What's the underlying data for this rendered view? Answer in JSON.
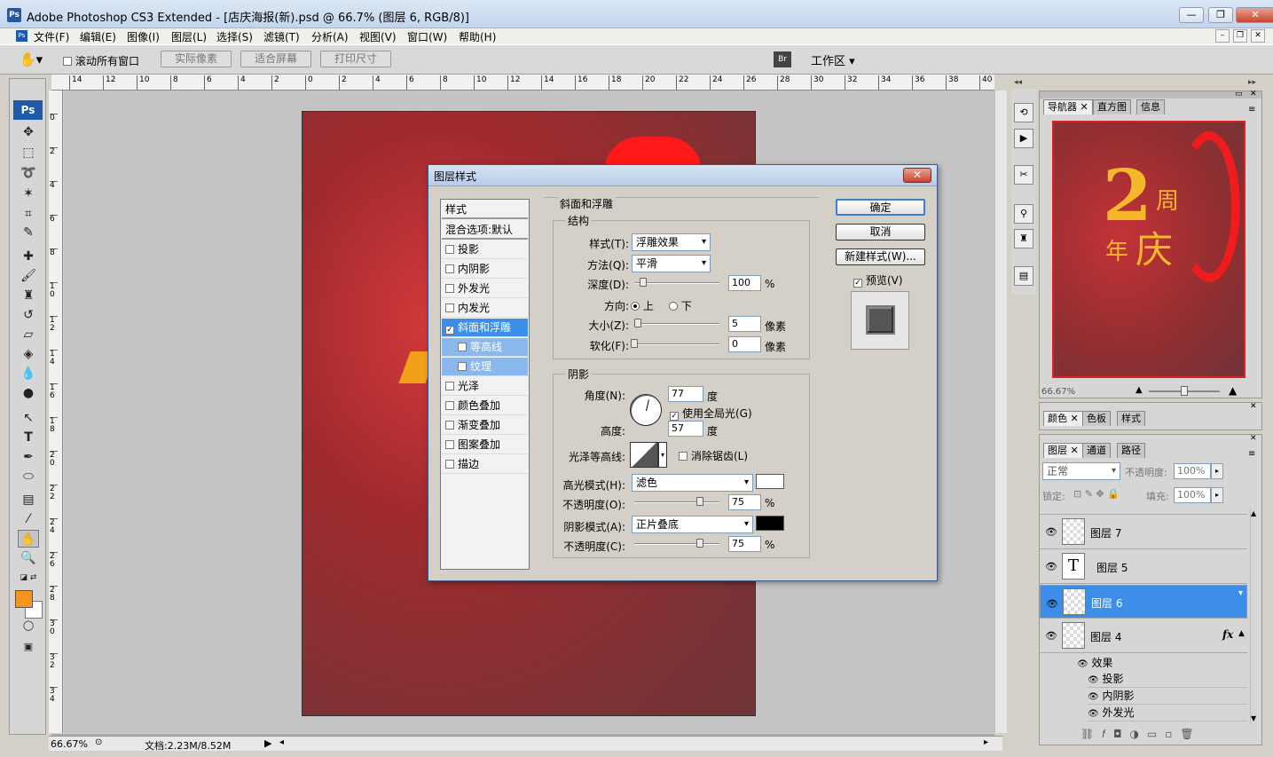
{
  "window": {
    "title": "Adobe Photoshop CS3 Extended - [店庆海报(新).psd @ 66.7% (图层 6, RGB/8)]",
    "ps_badge": "Ps"
  },
  "menu": [
    "文件(F)",
    "编辑(E)",
    "图像(I)",
    "图层(L)",
    "选择(S)",
    "滤镜(T)",
    "分析(A)",
    "视图(V)",
    "窗口(W)",
    "帮助(H)"
  ],
  "options": {
    "scroll_all": "滚动所有窗口",
    "actual_pixels": "实际像素",
    "fit_screen": "适合屏幕",
    "print_size": "打印尺寸",
    "workspace": "工作区 ▾"
  },
  "ruler_h": [
    "14",
    "12",
    "10",
    "8",
    "6",
    "4",
    "2",
    "0",
    "2",
    "4",
    "6",
    "8",
    "10",
    "12",
    "14",
    "16",
    "18",
    "20",
    "22",
    "24",
    "26",
    "28",
    "30",
    "32",
    "34",
    "36",
    "38",
    "40"
  ],
  "ruler_v": [
    "0",
    "2",
    "4",
    "6",
    "8",
    "10",
    "12",
    "14",
    "16",
    "18",
    "20",
    "22",
    "24",
    "26",
    "28",
    "30",
    "32",
    "34"
  ],
  "status": {
    "zoom": "66.67%",
    "doc": "文档:2.23M/8.52M"
  },
  "navigator": {
    "tabs": [
      "导航器",
      "直方图",
      "信息"
    ],
    "zoom": "66.67%",
    "art_big": "2",
    "art_zhou": "周",
    "art_nian": "年",
    "art_qing": "庆"
  },
  "color_panel": {
    "tabs": [
      "颜色",
      "色板",
      "样式"
    ]
  },
  "layers_panel": {
    "tabs": [
      "图层",
      "通道",
      "路径"
    ],
    "blend": "正常",
    "opacity_label": "不透明度:",
    "opacity": "100%",
    "lock_label": "锁定:",
    "fill_label": "填充:",
    "fill": "100%",
    "layers": [
      {
        "name": "图层 7",
        "selected": false,
        "type": "pixel"
      },
      {
        "name": "图层 5",
        "selected": false,
        "type": "text",
        "glyph": "T"
      },
      {
        "name": "图层 6",
        "selected": true,
        "type": "pixel"
      },
      {
        "name": "图层 4",
        "selected": false,
        "type": "pixel",
        "fx": "fx"
      }
    ],
    "effects_label": "效果",
    "effects": [
      "投影",
      "内阴影",
      "外发光"
    ]
  },
  "dialog": {
    "title": "图层样式",
    "styles": [
      {
        "label": "样式",
        "checkbox": false,
        "state": "header"
      },
      {
        "label": "混合选项:默认",
        "checkbox": false,
        "state": "header"
      },
      {
        "label": "投影",
        "checkbox": true,
        "checked": false,
        "state": ""
      },
      {
        "label": "内阴影",
        "checkbox": true,
        "checked": false,
        "state": ""
      },
      {
        "label": "外发光",
        "checkbox": true,
        "checked": false,
        "state": ""
      },
      {
        "label": "内发光",
        "checkbox": true,
        "checked": false,
        "state": ""
      },
      {
        "label": "斜面和浮雕",
        "checkbox": true,
        "checked": true,
        "state": "on"
      },
      {
        "label": "等高线",
        "checkbox": true,
        "checked": false,
        "state": "sub"
      },
      {
        "label": "纹理",
        "checkbox": true,
        "checked": false,
        "state": "sub"
      },
      {
        "label": "光泽",
        "checkbox": true,
        "checked": false,
        "state": ""
      },
      {
        "label": "颜色叠加",
        "checkbox": true,
        "checked": false,
        "state": ""
      },
      {
        "label": "渐变叠加",
        "checkbox": true,
        "checked": false,
        "state": ""
      },
      {
        "label": "图案叠加",
        "checkbox": true,
        "checked": false,
        "state": ""
      },
      {
        "label": "描边",
        "checkbox": true,
        "checked": false,
        "state": ""
      }
    ],
    "section": "斜面和浮雕",
    "structure": {
      "title": "结构",
      "style_label": "样式(T):",
      "style_value": "浮雕效果",
      "technique_label": "方法(Q):",
      "technique_value": "平滑",
      "depth_label": "深度(D):",
      "depth_value": "100",
      "depth_unit": "%",
      "direction_label": "方向:",
      "up": "上",
      "down": "下",
      "size_label": "大小(Z):",
      "size_value": "5",
      "size_unit": "像素",
      "soften_label": "软化(F):",
      "soften_value": "0",
      "soften_unit": "像素"
    },
    "shading": {
      "title": "阴影",
      "angle_label": "角度(N):",
      "angle_value": "77",
      "angle_unit": "度",
      "global_light": "使用全局光(G)",
      "altitude_label": "高度:",
      "altitude_value": "57",
      "altitude_unit": "度",
      "gloss_label": "光泽等高线:",
      "antialias": "消除锯齿(L)",
      "highlight_label": "高光模式(H):",
      "highlight_mode": "滤色",
      "highlight_color": "#ffffff",
      "hl_opacity_label": "不透明度(O):",
      "hl_opacity": "75",
      "hl_unit": "%",
      "shadow_label": "阴影模式(A):",
      "shadow_mode": "正片叠底",
      "shadow_color": "#000000",
      "sh_opacity_label": "不透明度(C):",
      "sh_opacity": "75",
      "sh_unit": "%"
    },
    "buttons": {
      "ok": "确定",
      "cancel": "取消",
      "new_style": "新建样式(W)...",
      "preview": "预览(V)"
    }
  },
  "colors": {
    "foreground": "#f7941d",
    "background": "#ffffff",
    "selection": "#3d8ee8"
  }
}
